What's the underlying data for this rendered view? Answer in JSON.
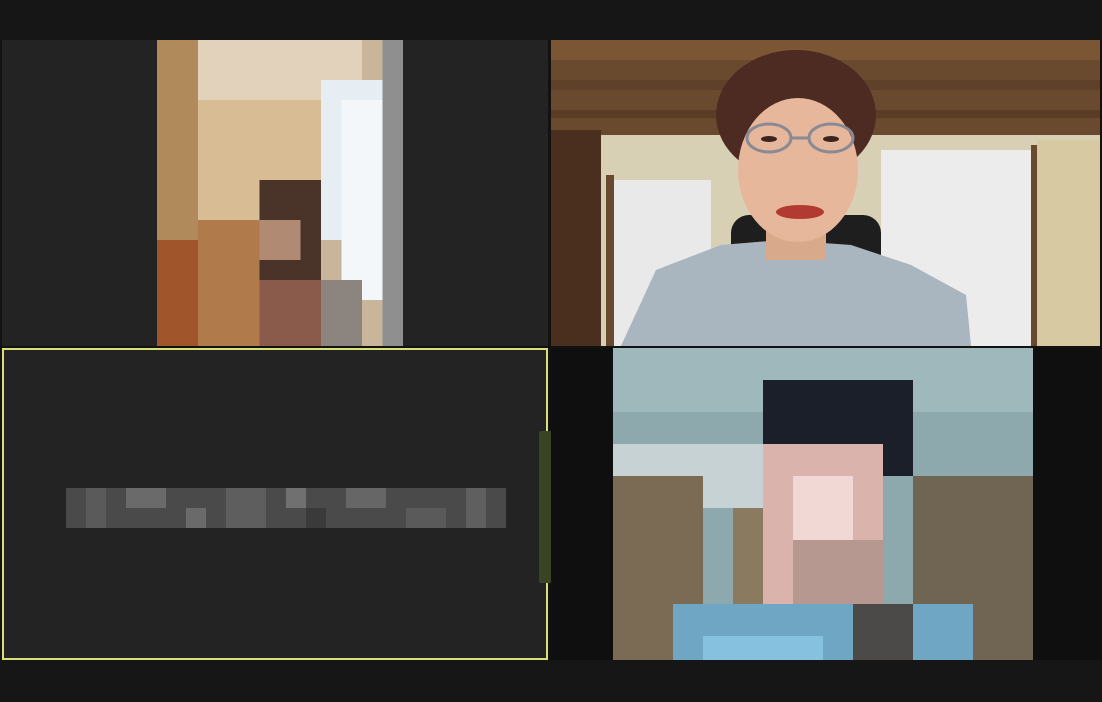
{
  "window": {
    "title": ""
  },
  "participants": [
    {
      "id": "p1",
      "label": ""
    },
    {
      "id": "p2",
      "label": ""
    },
    {
      "id": "p3",
      "label": ""
    },
    {
      "id": "p4",
      "label": ""
    }
  ],
  "colors": {
    "background": "#121212",
    "tile": "#232323",
    "active_speaker_border": "#d9e07a"
  }
}
